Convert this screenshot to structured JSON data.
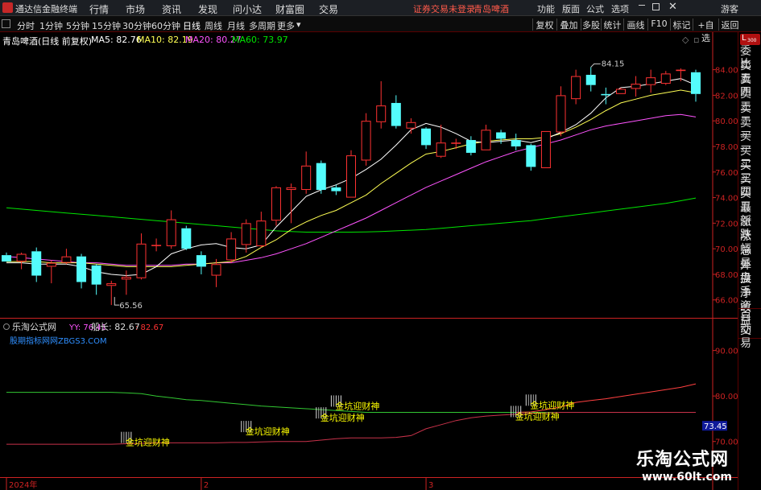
{
  "app": {
    "title": "通达信金融终端",
    "menus": [
      "行情",
      "市场",
      "资讯",
      "发现",
      "问小达",
      "财富圈",
      "交易"
    ],
    "warning": "证券交易未登录",
    "stock_name": "青岛啤酒",
    "right_menus": [
      "功能",
      "版面",
      "公式",
      "选项"
    ],
    "guest": "游客"
  },
  "period_tabs": [
    "分时",
    "1分钟",
    "5分钟",
    "15分钟",
    "30分钟",
    "60分钟",
    "日线",
    "周线",
    "月线",
    "多周期",
    "更多"
  ],
  "active_period": "日线",
  "tool_buttons": [
    "复权",
    "叠加",
    "多股",
    "统计",
    "画线",
    "F10",
    "标记",
    "+自选",
    "返回"
  ],
  "info": {
    "name": "青岛啤酒(日线 前复权)",
    "ma5": "MA5: 82.76",
    "ma10": "MA10: 82.19",
    "ma20": "MA20: 80.27",
    "ma60": "MA60: 73.97"
  },
  "right_panel": {
    "badge_top": "L",
    "badge_bottom": "300",
    "items": [
      "委比",
      "卖五",
      "卖四",
      "卖三",
      "卖二",
      "卖一",
      "买一",
      "买二",
      "买三",
      "买四",
      "买五",
      "最新",
      "涨跌",
      "涨幅",
      "总量",
      "外盘",
      "换手",
      "净资",
      "收益"
    ],
    "auto_trade": [
      "自动",
      "交易"
    ]
  },
  "colors": {
    "up": "#ff3232",
    "down": "#54fcfc",
    "ma5": "#ffffff",
    "ma10": "#ffff54",
    "ma20": "#ff54ff",
    "ma60": "#00e600",
    "axis": "#cc2222",
    "upper_line": "#ff4040",
    "lower_line": "#c8324a",
    "green_line": "#32c832",
    "signal_text": "#ffff00",
    "link": "#2f8fff",
    "value_label_bg": "#101a9a"
  },
  "chart_data": {
    "type": "candlestick",
    "y_ticks": [
      "84.00",
      "82.00",
      "80.00",
      "78.00",
      "76.00",
      "74.00",
      "72.00",
      "70.00",
      "68.00",
      "66.00"
    ],
    "y_ticks_values": [
      84,
      82,
      80,
      78,
      76,
      74,
      72,
      70,
      68,
      66
    ],
    "ylim": [
      64.6,
      85.8
    ],
    "max_label": "84.15",
    "min_label": "65.56",
    "candles": [
      [
        69.5,
        69.0,
        69.7,
        69.3
      ],
      [
        69.0,
        69.6,
        69.7,
        68.4
      ],
      [
        69.8,
        67.9,
        70.1,
        67.4
      ],
      [
        68.6,
        68.9,
        69.1,
        67.3
      ],
      [
        68.9,
        69.4,
        70.0,
        68.8
      ],
      [
        69.4,
        67.4,
        69.6,
        66.9
      ],
      [
        68.7,
        67.2,
        68.8,
        66.4
      ],
      [
        67.1,
        67.3,
        67.5,
        65.6
      ],
      [
        67.6,
        67.8,
        68.3,
        66.4
      ],
      [
        67.7,
        70.4,
        71.2,
        67.6
      ],
      [
        70.3,
        70.3,
        70.8,
        69.8
      ],
      [
        70.2,
        72.3,
        73.0,
        70.0
      ],
      [
        71.6,
        70.0,
        71.8,
        69.9
      ],
      [
        69.5,
        68.6,
        69.8,
        68.0
      ],
      [
        67.9,
        68.8,
        69.2,
        67.0
      ],
      [
        69.1,
        70.8,
        71.3,
        68.9
      ],
      [
        70.3,
        72.0,
        72.3,
        69.7
      ],
      [
        70.2,
        72.2,
        72.9,
        70.1
      ],
      [
        72.2,
        74.8,
        74.9,
        71.8
      ],
      [
        74.6,
        74.8,
        75.1,
        72.0
      ],
      [
        74.6,
        76.5,
        77.6,
        74.3
      ],
      [
        76.7,
        74.6,
        76.9,
        74.3
      ],
      [
        74.8,
        74.5,
        75.0,
        74.2
      ],
      [
        74.0,
        77.3,
        77.7,
        74.0
      ],
      [
        76.9,
        80.0,
        80.6,
        76.5
      ],
      [
        79.9,
        81.2,
        83.1,
        79.4
      ],
      [
        81.4,
        79.6,
        82.0,
        79.4
      ],
      [
        79.4,
        79.9,
        80.2,
        79.0
      ],
      [
        79.4,
        78.1,
        79.5,
        77.8
      ],
      [
        77.2,
        78.3,
        79.7,
        77.1
      ],
      [
        78.3,
        78.3,
        78.6,
        77.8
      ],
      [
        78.5,
        77.5,
        78.8,
        77.3
      ],
      [
        77.7,
        79.3,
        79.7,
        77.7
      ],
      [
        79.1,
        78.6,
        79.3,
        78.2
      ],
      [
        78.5,
        78.0,
        79.0,
        77.7
      ],
      [
        78.1,
        76.4,
        78.2,
        76.1
      ],
      [
        76.3,
        79.2,
        79.2,
        76.3
      ],
      [
        79.1,
        82.0,
        82.7,
        78.8
      ],
      [
        81.7,
        83.5,
        84.0,
        81.3
      ],
      [
        83.6,
        82.8,
        84.2,
        82.3
      ],
      [
        82.1,
        82.0,
        82.6,
        81.3
      ],
      [
        82.1,
        82.5,
        82.6,
        82.1
      ],
      [
        82.5,
        82.9,
        83.5,
        81.9
      ],
      [
        82.8,
        83.4,
        84.0,
        82.2
      ],
      [
        82.9,
        83.7,
        83.9,
        82.8
      ],
      [
        83.9,
        84.0,
        84.1,
        83.1
      ],
      [
        83.8,
        82.1,
        84.0,
        81.5
      ]
    ],
    "ma5": [
      68.9,
      68.9,
      68.8,
      68.8,
      68.8,
      68.6,
      68.2,
      68.0,
      67.9,
      68.0,
      68.6,
      69.6,
      70.0,
      70.3,
      70.4,
      70.1,
      70.0,
      70.3,
      71.7,
      72.9,
      74.1,
      74.6,
      75.0,
      75.5,
      76.2,
      77.0,
      78.1,
      79.3,
      79.8,
      79.5,
      79.0,
      78.4,
      78.3,
      78.4,
      78.5,
      78.3,
      78.6,
      79.1,
      79.7,
      80.6,
      81.8,
      82.6,
      82.7,
      82.9,
      83.1,
      83.3,
      82.8
    ],
    "ma10": [
      69.0,
      69.0,
      69.0,
      68.9,
      68.9,
      68.9,
      68.8,
      68.7,
      68.6,
      68.6,
      68.6,
      68.6,
      68.7,
      68.8,
      68.9,
      69.0,
      69.4,
      70.1,
      70.7,
      71.5,
      72.1,
      72.6,
      73.0,
      73.6,
      74.2,
      75.1,
      75.9,
      76.7,
      77.4,
      77.6,
      77.9,
      78.2,
      78.4,
      78.5,
      78.6,
      78.6,
      78.7,
      79.0,
      79.5,
      80.1,
      80.8,
      81.4,
      81.7,
      82.0,
      82.2,
      82.4,
      82.2
    ],
    "ma20": [
      69.4,
      69.3,
      69.2,
      69.1,
      69.0,
      68.9,
      68.9,
      68.8,
      68.7,
      68.7,
      68.7,
      68.7,
      68.8,
      68.8,
      68.9,
      68.9,
      69.1,
      69.3,
      69.6,
      70.0,
      70.4,
      70.9,
      71.4,
      71.9,
      72.4,
      73.0,
      73.6,
      74.2,
      74.8,
      75.3,
      75.8,
      76.3,
      76.8,
      77.2,
      77.6,
      77.9,
      78.2,
      78.5,
      78.9,
      79.3,
      79.6,
      79.8,
      80.0,
      80.2,
      80.4,
      80.5,
      80.3
    ],
    "ma60": [
      73.2,
      73.1,
      73.0,
      72.9,
      72.8,
      72.7,
      72.6,
      72.5,
      72.4,
      72.3,
      72.2,
      72.1,
      72.0,
      71.9,
      71.8,
      71.7,
      71.6,
      71.5,
      71.4,
      71.35,
      71.3,
      71.3,
      71.3,
      71.3,
      71.32,
      71.35,
      71.4,
      71.45,
      71.5,
      71.6,
      71.7,
      71.8,
      71.9,
      72.0,
      72.1,
      72.2,
      72.35,
      72.5,
      72.65,
      72.8,
      72.95,
      73.1,
      73.25,
      73.4,
      73.55,
      73.75,
      73.97
    ],
    "x_labels": [
      "2024年",
      "2",
      "3"
    ],
    "x_label_idx": [
      0,
      13,
      28
    ],
    "indicator": {
      "name": "乐淘公式网",
      "yy": "YY: 76.41",
      "ship": "船长: 82.67",
      "ship_val": ": 82.67",
      "link": "股期指标网网ZBGS3.COM",
      "y_ticks": [
        "90.00",
        "80.00",
        "70.00"
      ],
      "y_ticks_values": [
        90,
        80,
        70
      ],
      "ylim": [
        62.7,
        96.3
      ],
      "value_label": "73.45",
      "value_label_val": 73.45,
      "green": [
        80.8,
        80.8,
        80.8,
        80.8,
        80.8,
        80.8,
        80.8,
        80.8,
        80.7,
        80.5,
        80.0,
        79.6,
        79.2,
        79.0,
        78.7,
        78.4,
        78.1,
        77.8,
        77.6,
        77.4,
        77.2,
        77.0,
        76.8,
        76.6,
        76.4,
        76.4,
        76.4,
        76.4,
        76.4,
        76.4,
        76.4,
        76.4,
        76.4,
        76.4,
        76.4,
        76.4,
        76.4,
        76.4,
        76.4,
        76.4,
        76.4,
        76.4,
        76.4,
        76.4,
        76.4,
        76.4,
        76.4
      ],
      "upper": [
        null,
        null,
        null,
        null,
        null,
        null,
        null,
        null,
        null,
        null,
        null,
        null,
        null,
        null,
        null,
        null,
        null,
        null,
        null,
        null,
        null,
        null,
        null,
        null,
        null,
        null,
        null,
        null,
        null,
        null,
        null,
        null,
        null,
        null,
        76.4,
        76.5,
        77.0,
        77.6,
        78.6,
        79.0,
        79.4,
        79.9,
        80.4,
        80.9,
        81.4,
        81.9,
        82.67
      ],
      "lower": [
        69.4,
        69.4,
        69.4,
        69.4,
        69.4,
        69.4,
        69.4,
        69.4,
        69.5,
        69.6,
        69.7,
        69.7,
        69.7,
        69.7,
        69.7,
        69.8,
        69.8,
        69.9,
        70.0,
        70.0,
        70.0,
        70.3,
        70.6,
        70.8,
        70.8,
        70.8,
        70.9,
        71.3,
        72.8,
        73.7,
        74.6,
        75.2,
        75.6,
        75.8,
        76.0,
        76.2,
        76.3,
        76.4,
        76.41,
        76.41,
        76.41,
        76.41,
        76.41,
        76.41,
        76.41,
        76.41,
        76.41
      ],
      "signal_text": "金坑迎财神",
      "signals": [
        {
          "i": 8,
          "v": 71.6
        },
        {
          "i": 16,
          "v": 74.0
        },
        {
          "i": 21,
          "v": 77.0
        },
        {
          "i": 22,
          "v": 79.6
        },
        {
          "i": 34,
          "v": 77.3
        },
        {
          "i": 35,
          "v": 79.8
        }
      ]
    }
  },
  "watermark": {
    "line1": "乐淘公式网",
    "line2": "www.60lt.com"
  }
}
